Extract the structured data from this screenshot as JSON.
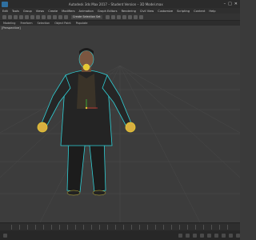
{
  "window": {
    "title": "Autodesk 3ds Max 2017 – Student Version – 3D Model.max",
    "controls": [
      "–",
      "□",
      "✕"
    ]
  },
  "menubar": {
    "items": [
      "Edit",
      "Tools",
      "Group",
      "Views",
      "Create",
      "Modifiers",
      "Animation",
      "Graph Editors",
      "Rendering",
      "Civil View",
      "Customize",
      "Scripting",
      "Content",
      "Help"
    ]
  },
  "toolbar": {
    "selection_set_label": "Create Selection Set"
  },
  "ribbon": {
    "tabs": [
      "Modeling",
      "Freeform",
      "Selection",
      "Object Paint",
      "Populate"
    ]
  },
  "viewport": {
    "label": "[Perspective]"
  },
  "colors": {
    "viewport_bg": "#3c3c3c",
    "selection_outline": "#2fd0d6",
    "highlight_yellow": "#e6c832"
  }
}
